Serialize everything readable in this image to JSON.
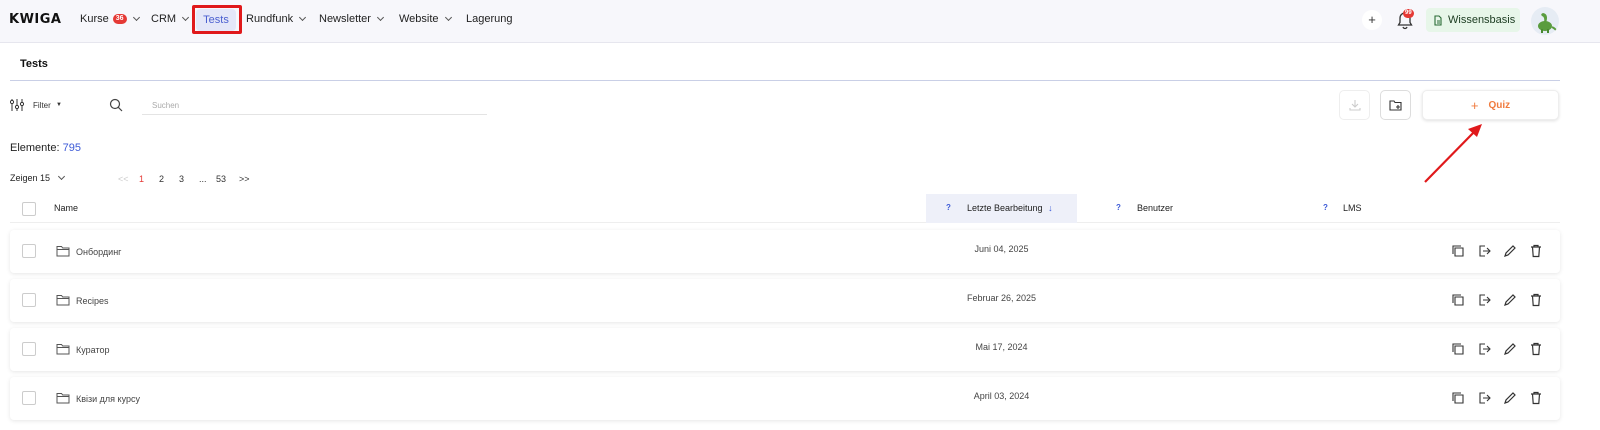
{
  "brand": {
    "logo": "KWIGA"
  },
  "nav": {
    "kurse": "Kurse",
    "kurse_badge": "36",
    "crm": "CRM",
    "tests": "Tests",
    "rundfunk": "Rundfunk",
    "newsletter": "Newsletter",
    "website": "Website",
    "lagerung": "Lagerung"
  },
  "header_right": {
    "plus": "+",
    "bell_badge": "99",
    "wissensbasis": "Wissensbasis"
  },
  "page": {
    "title": "Tests"
  },
  "toolbar": {
    "filter_label": "Filter",
    "search_placeholder": "Suchen",
    "quiz_label": "Quiz",
    "quiz_plus": "+"
  },
  "summary": {
    "label": "Elemente:",
    "count": "795"
  },
  "pager": {
    "show_label": "Zeigen 15",
    "first": "<<",
    "pages": [
      "1",
      "2",
      "3"
    ],
    "ellipsis": "...",
    "last_page": "53",
    "next": ">>"
  },
  "table": {
    "col_name": "Name",
    "col_help": "?",
    "col_last_edit": "Letzte Bearbeitung",
    "col_sort_arrow": "↓",
    "col_user": "Benutzer",
    "col_lms": "LMS",
    "rows": [
      {
        "name": "Онбординг",
        "date": "Juni 04, 2025"
      },
      {
        "name": "Recipes",
        "date": "Februar 26, 2025"
      },
      {
        "name": "Куратор",
        "date": "Mai 17, 2024"
      },
      {
        "name": "Квізи для курсу",
        "date": "April 03, 2024"
      }
    ]
  },
  "colors": {
    "accent": "#3c5ad7",
    "quiz": "#f07a3d",
    "highlight": "#e0191b",
    "active_page": "#e53935"
  }
}
